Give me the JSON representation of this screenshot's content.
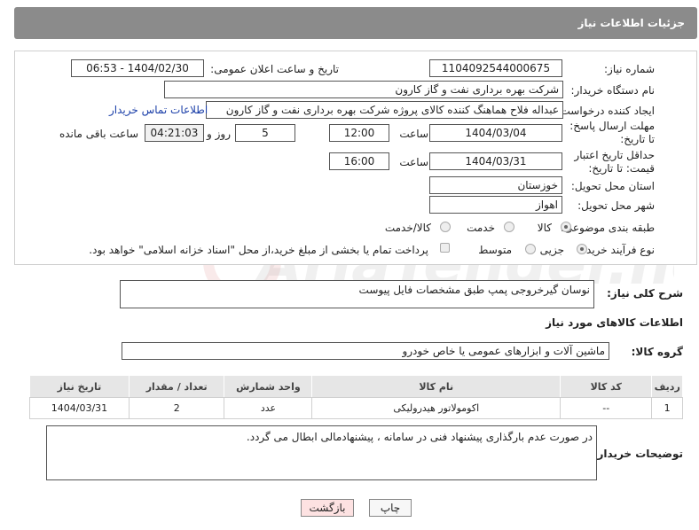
{
  "header": {
    "title": "جزئیات اطلاعات نیاز"
  },
  "form": {
    "need_number_label": "شماره نیاز:",
    "need_number": "1104092544000675",
    "announce_label": "تاریخ و ساعت اعلان عمومی:",
    "announce_value": "1404/02/30 - 06:53",
    "buyer_label": "نام دستگاه خریدار:",
    "buyer_value": "شرکت بهره برداری نفت و گاز کارون",
    "creator_label": "ایجاد کننده درخواست:",
    "creator_value": "عبداله فلاح هماهنگ کننده کالای پروژه شرکت بهره برداری نفت و گاز کارون",
    "contact_link": "اطلاعات تماس خریدار",
    "deadline_label": "مهلت ارسال پاسخ: تا تاریخ:",
    "deadline_date": "1404/03/04",
    "time_label": "ساعت",
    "deadline_time": "12:00",
    "days_value": "5",
    "days_label": "روز و",
    "remaining_value": "04:21:03",
    "remaining_label": "ساعت باقی مانده",
    "price_label": "حداقل تاریخ اعتبار قیمت: تا تاریخ:",
    "price_date": "1404/03/31",
    "price_time": "16:00",
    "province_label": "استان محل تحویل:",
    "province_value": "خوزستان",
    "city_label": "شهر محل تحویل:",
    "city_value": "اهواز",
    "category_label": "طبقه بندی موضوعی:",
    "category_options": [
      "کالا",
      "خدمت",
      "کالا/خدمت"
    ],
    "process_label": "نوع فرآیند خرید :",
    "process_options": [
      "جزیی",
      "متوسط"
    ],
    "payment_note": "پرداخت تمام یا بخشی از مبلغ خرید،از محل \"اسناد خزانه اسلامی\" خواهد بود."
  },
  "description": {
    "label": "شرح کلی نیاز:",
    "value": "نوسان گیرخروجی پمپ طبق مشخصات فایل پیوست"
  },
  "goods_info": {
    "title": "اطلاعات کالاهای مورد نیاز",
    "group_label": "گروه کالا:",
    "group_value": "ماشین آلات و ابزارهای عمومی یا خاص خودرو",
    "columns": [
      "ردیف",
      "کد کالا",
      "نام کالا",
      "واحد شمارش",
      "تعداد / مقدار",
      "تاریخ نیاز"
    ],
    "rows": [
      [
        "1",
        "--",
        "اکومولاتور هیدرولیکی",
        "عدد",
        "2",
        "1404/03/31"
      ]
    ]
  },
  "buyer_notes": {
    "label": "توضیحات خریدار:",
    "value": "در صورت عدم بارگذاری پیشنهاد فنی در سامانه ، پیشنهادمالی ابطال می گردد."
  },
  "footer": {
    "print_label": "چاپ",
    "back_label": "بازگشت"
  },
  "watermark": {
    "text": "AriaTender.net"
  },
  "colors": {
    "header": "#8b8b8b",
    "link": "#1a3ea8",
    "back_button": "#fde2e2"
  }
}
